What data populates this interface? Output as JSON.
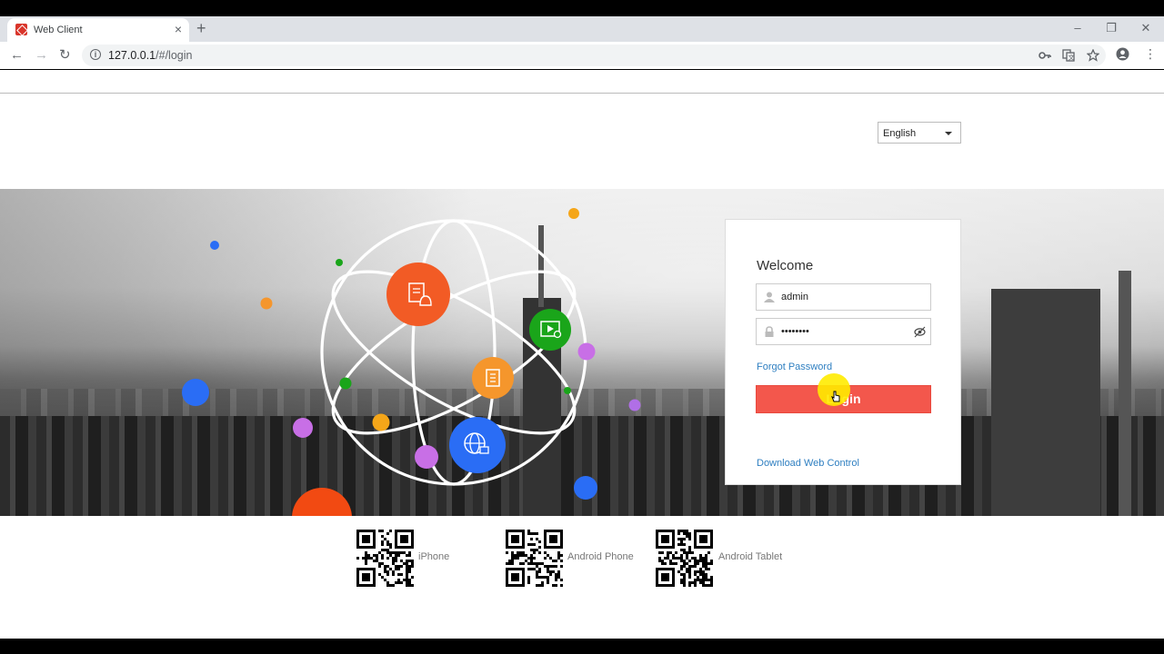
{
  "browser": {
    "tab_title": "Web Client",
    "tab_close": "×",
    "new_tab": "+",
    "url_host": "127.0.0.1",
    "url_path": "/#/login",
    "window_controls": {
      "minimize": "–",
      "maximize": "❐",
      "close": "✕"
    },
    "nav": {
      "back": "←",
      "forward": "→",
      "reload": "↻"
    },
    "menu": "⋮"
  },
  "language_select": {
    "value": "English"
  },
  "login": {
    "welcome": "Welcome",
    "username": "admin",
    "password": "••••••••",
    "forgot_password": "Forgot Password",
    "login_label": "Login",
    "download_web_control": "Download Web Control"
  },
  "apps": [
    {
      "label": "iPhone"
    },
    {
      "label": "Android Phone"
    },
    {
      "label": "Android Tablet"
    }
  ],
  "colors": {
    "login_button": "#f3574c",
    "link": "#2f7fc1",
    "node_orange_red": "#f25b25",
    "node_green": "#1aa51a",
    "node_orange": "#f5962c",
    "node_blue": "#2a6df5",
    "dot_purple": "#c86fe6"
  },
  "icons": [
    "key-icon",
    "translate-icon",
    "star-icon",
    "account-icon",
    "user-icon",
    "lock-icon",
    "eye-icon",
    "alarm-icon",
    "video-icon",
    "building-icon",
    "globe-icon"
  ]
}
